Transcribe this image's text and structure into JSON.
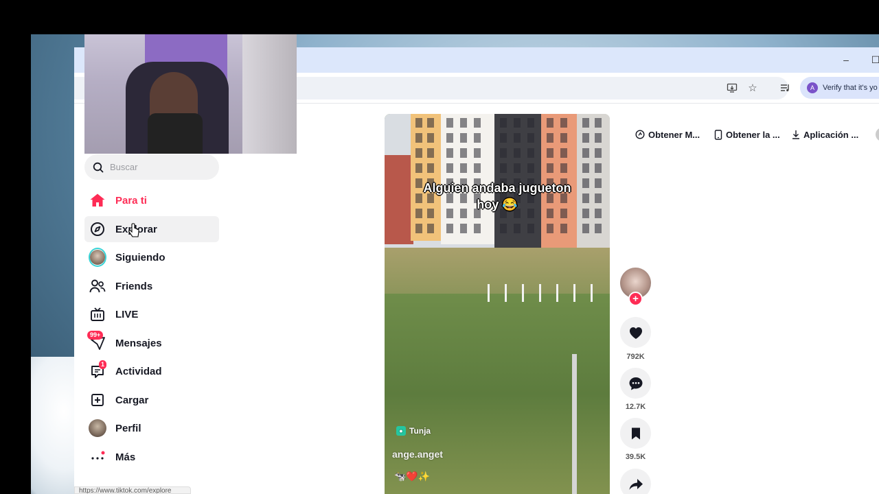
{
  "browser": {
    "verify_text": "Verify that it's yo",
    "verify_avatar_letter": "A",
    "status_url": "https://www.tiktok.com/explore"
  },
  "sidebar": {
    "search_placeholder": "Buscar",
    "items": [
      {
        "label": "Para ti",
        "icon": "home-icon",
        "active": true
      },
      {
        "label": "Explorar",
        "icon": "compass-icon"
      },
      {
        "label": "Siguiendo",
        "icon": "following-avatar"
      },
      {
        "label": "Friends",
        "icon": "friends-icon"
      },
      {
        "label": "LIVE",
        "icon": "live-icon"
      },
      {
        "label": "Mensajes",
        "icon": "messages-icon",
        "badge": "99+"
      },
      {
        "label": "Actividad",
        "icon": "activity-icon",
        "badge": "1"
      },
      {
        "label": "Cargar",
        "icon": "upload-icon"
      },
      {
        "label": "Perfil",
        "icon": "profile-avatar"
      },
      {
        "label": "Más",
        "icon": "more-icon"
      }
    ]
  },
  "video": {
    "caption": "Alguien andaba jugueton hoy 😂",
    "location": "Tunja",
    "username": "ange.anget",
    "emoji_line": "🐄❤️✨"
  },
  "actions": {
    "likes": "792K",
    "comments": "12.7K",
    "saves": "39.5K"
  },
  "top_links": {
    "link1": "Obtener M...",
    "link2": "Obtener la ...",
    "link3": "Aplicación ..."
  },
  "colors": {
    "accent": "#fe2c55",
    "following_ring": "#36d3d6",
    "location_badge": "#25c6a0"
  }
}
